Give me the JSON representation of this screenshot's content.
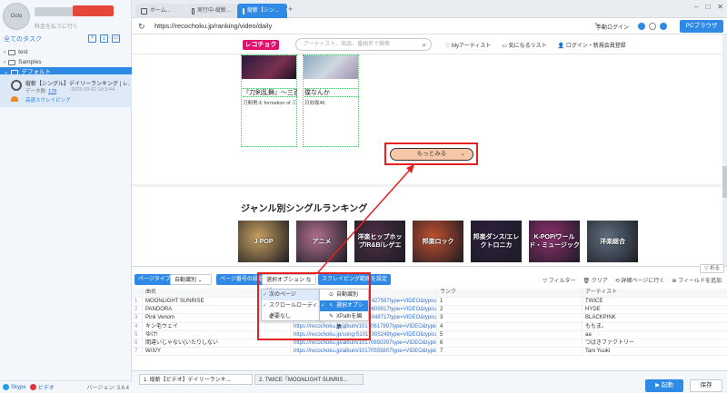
{
  "sidebar": {
    "avatar_text": "Octo",
    "user_role": "料金を払うに行く",
    "all_tasks": "全てのタスク",
    "tree": [
      {
        "label": "test"
      },
      {
        "label": "Samples"
      },
      {
        "label": "デフォルト"
      }
    ],
    "task": {
      "title": "縦斬【シングル】デイリーランキング | レ...",
      "data_label": "データ数:",
      "data_count": "178",
      "date": "2023-03-02 18:3:44",
      "mode": "高速スクレイピング"
    },
    "footer": {
      "skype": "Skype",
      "video": "ビデオ",
      "version": "バージョン: 3.6.4"
    }
  },
  "browser": {
    "tabs": [
      {
        "label": "ホーム..."
      },
      {
        "label": "実行中-縦斬..."
      },
      {
        "label": "縦斬【シン..."
      }
    ],
    "url": "https://recochoku.jp/ranking/video/daily",
    "login_label": "手動ログイン",
    "pc_browser": "PCブラウザ",
    "win_controls": [
      "‒",
      "□",
      "✕"
    ]
  },
  "website": {
    "logo": "レコチョク",
    "search_placeholder": "アーティスト、商品、番組名で検索",
    "header_links": [
      "♡ Myアーティスト",
      "▭ 気になるリスト",
      "👤 ログイン・新規会員登録"
    ],
    "songs": [
      {
        "title": "『刀剣乱舞』〜三百...",
        "artist": "刀剣男士 formation of 三百"
      },
      {
        "title": "僕なんか",
        "artist": "日向坂46"
      }
    ],
    "more_button": "もっとみる",
    "genre_heading": "ジャンル別シングルランキング",
    "genres": [
      {
        "label": "J-POP",
        "color": "#c8a060"
      },
      {
        "label": "アニメ",
        "color": "#b07090"
      },
      {
        "label": "洋楽ヒップホップ/R&B/レゲエ",
        "color": "#503048"
      },
      {
        "label": "邦楽ロック",
        "color": "#c05030"
      },
      {
        "label": "邦楽ダンス/エレクトロニカ",
        "color": "#302040"
      },
      {
        "label": "K-POP/ワールド・ミュージック",
        "color": "#903070"
      },
      {
        "label": "洋楽総合",
        "color": "#607080"
      }
    ]
  },
  "panel": {
    "collapse": "▽ 折る",
    "page_type_btn": "ページタイプ",
    "page_type_val": "自動識別",
    "page_num_btn": "ページ番号の設定",
    "dropdown_val": "選択オプション など",
    "scrape_range": "スクレイピング範囲を設定",
    "right_tools": [
      "▽ フィルター",
      "🗑 クリア",
      "⟲ 詳細ページに行く",
      "⊕ フィールドを追加"
    ],
    "menu1": [
      "次のページ",
      "スクロールローディング",
      "必要なし"
    ],
    "menu2": [
      "自動識別",
      "選択オプション",
      "XPathを編集..."
    ],
    "headers": [
      "曲名",
      "曲名のリンク",
      "ランク",
      "アーティスト"
    ],
    "rows": [
      [
        "MOONLIGHT SUNRISE",
        "https://recochoku.jp/song/S1007427567type=VIDEO&typica...",
        "1",
        "TWICE"
      ],
      [
        "PANDORA",
        "https://recochoku.jp/song/S1010609917type=VIDEO&typica...",
        "2",
        "HYDE"
      ],
      [
        "Pink Venom",
        "https://recochoku.jp/song/S1003048717type=VIDEO&typica...",
        "3",
        "BLACKPINK"
      ],
      [
        "キン毛ウェイ",
        "https://recochoku.jp/album/10170617897type=VIDEO&typica...",
        "4",
        "ももま。"
      ],
      [
        "ゆけ!",
        "https://recochoku.jp/song/S1017005249type=VIDEO&typica...",
        "5",
        "aa"
      ],
      [
        "間違いじゃない(いたりしない",
        "https://recochoku.jp/album/10170850397type=VIDEO&typica...",
        "6",
        "つばきファクトリー"
      ],
      [
        "W/X/Y",
        "https://recochoku.jp/album/10170555807type=VIDEO&typica...",
        "7",
        "Tani Yuuki"
      ]
    ]
  },
  "statusbar": {
    "tabs": [
      "1. 縦斬【ビデオ】デイリーランキ...",
      "2. TWICE「MOONLIGHT SUNRIS..."
    ],
    "start": "▶ 起動",
    "save": "保存"
  }
}
